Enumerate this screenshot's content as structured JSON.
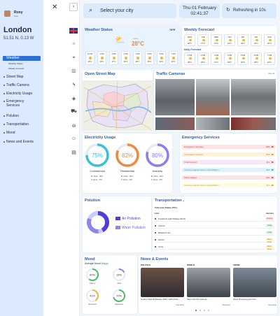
{
  "user": {
    "name": "Rony",
    "role": "User"
  },
  "city": {
    "name": "London",
    "coords": "51.51 N, 0.13 W"
  },
  "nav": [
    {
      "label": "Weather",
      "active": true,
      "children": [
        "Weather Status",
        "Weekly Forecast"
      ]
    },
    {
      "label": "Street Map"
    },
    {
      "label": "Traffic Camera"
    },
    {
      "label": "Electricity Usage"
    },
    {
      "label": "Emergency Services"
    },
    {
      "label": "Polution"
    },
    {
      "label": "Transportation"
    },
    {
      "label": "Mood"
    },
    {
      "label": "News and Events"
    }
  ],
  "header": {
    "search_placeholder": "Select your city",
    "date": "Thu 01 February",
    "time": "02:41:37",
    "refresh": "Refreshing in 10s"
  },
  "weather": {
    "title": "Weather Status",
    "temp": "28°C",
    "small_temp": "79°F",
    "label": "Clear",
    "hours": [
      "12 PM",
      "1 PM",
      "2 PM",
      "3 PM",
      "4 PM",
      "5 PM",
      "6 PM",
      "7 PM"
    ],
    "hour_temps": [
      "28°C",
      "28°C",
      "27°C",
      "26°C",
      "26°C",
      "25°C",
      "24°C",
      "23°C"
    ]
  },
  "forecast": {
    "title": "Weekly Forecast",
    "daily_title": "Daily Forecast",
    "days": [
      "MON",
      "TUE",
      "WED",
      "THU",
      "FRI",
      "SAT",
      "SUN"
    ],
    "temps": [
      "28°C",
      "27°C",
      "27°C",
      "26°C",
      "28°C",
      "29°C",
      "30°C"
    ],
    "hours": [
      "1 PM",
      "2 PM",
      "3 PM",
      "4 PM",
      "5 PM",
      "6 PM",
      "7 PM"
    ],
    "hour_temps": [
      "28°C",
      "28°C",
      "27°C",
      "26°C",
      "26°C",
      "25°C",
      "24°C"
    ]
  },
  "map": {
    "title": "Open Street Map"
  },
  "cameras": {
    "title": "Traffic Cameras",
    "more": "View All"
  },
  "electricity": {
    "title": "Electricity Usage",
    "gauges": [
      {
        "name": "Commercial",
        "value": "75%",
        "pct": 75,
        "color": "#3cc0d8",
        "legend": [
          "Urban - 80%",
          "Rural - 70%"
        ]
      },
      {
        "name": "Residential",
        "value": "82%",
        "pct": 82,
        "color": "#f0883e",
        "legend": [
          "Urban - 85%",
          "Rural - 76%"
        ]
      },
      {
        "name": "Industry",
        "value": "80%",
        "pct": 80,
        "color": "#8f7cf0",
        "legend": [
          "Urban - 82%",
          "Rural - 78%"
        ]
      }
    ]
  },
  "emergency": {
    "title": "Emergency Services",
    "rows": [
      {
        "label": "Emergency Services",
        "value": "999",
        "bg": "#fde4e4",
        "color": "#d33"
      },
      {
        "label": "Information Services",
        "value": "333",
        "bg": "#fff1dc",
        "color": "#d28a1e"
      },
      {
        "label": "Child Support",
        "value": "111",
        "bg": "#f7e6f3",
        "color": "#c44"
      },
      {
        "label": "Violence against women and children",
        "value": "444",
        "bg": "#def3f8",
        "color": "#2a8fb0"
      },
      {
        "label": "Police Station",
        "value": "200",
        "bg": "#fde4e4",
        "color": "#d33"
      },
      {
        "label": "Violence against women and children",
        "value": "444",
        "bg": "#fffbe0",
        "color": "#c59a00"
      }
    ]
  },
  "pollution": {
    "title": "Polution",
    "legend": [
      "Air Pollution",
      "Water Pollution"
    ]
  },
  "transport": {
    "title": "Transportation",
    "subtitle": "Tube Line Status (TFL)",
    "col_line": "Line",
    "col_service": "Service",
    "lines": [
      {
        "name": "Docklands Light Railway (DLR)",
        "status": "Closure",
        "bg": "#fde4e4",
        "color": "#c33"
      },
      {
        "name": "Victoria",
        "status": "Good",
        "bg": "#e1f5e1",
        "color": "#2c8a2c"
      },
      {
        "name": "Elizabeth Line",
        "status": "Good",
        "bg": "#e1f5e1",
        "color": "#2c8a2c"
      },
      {
        "name": "District",
        "status": "Minor Delay",
        "bg": "#fff3d6",
        "color": "#b07d00"
      },
      {
        "name": "Circle",
        "status": "Minor Delay",
        "bg": "#fff3d6",
        "color": "#b07d00"
      }
    ]
  },
  "mood": {
    "title": "Mood",
    "avg_label": "Average Mood",
    "avg_value": "Happy",
    "items": [
      {
        "value": "60%",
        "pct": 60,
        "label": "Happy",
        "color": "#4cbb6a"
      },
      {
        "value": "18%",
        "pct": 18,
        "label": "Sad",
        "color": "#8f7cf0"
      },
      {
        "value": "41%",
        "pct": 41,
        "label": "Stressed",
        "color": "#f0b23a"
      },
      {
        "value": "70%",
        "pct": 70,
        "label": "Relaxed",
        "color": "#4cbb6a"
      }
    ]
  },
  "news": {
    "title": "News & Events",
    "cards": [
      {
        "tag": "POLITICS",
        "more": "View Here",
        "caption": "London Mayoral Election 2024: Sadiq Khan..."
      },
      {
        "tag": "WORLD",
        "more": "View Here",
        "caption": "Storm hits the coast as ..."
      },
      {
        "tag": "CRIME",
        "more": "View Here",
        "caption": "Greta Thunberg goes from ..."
      }
    ]
  }
}
